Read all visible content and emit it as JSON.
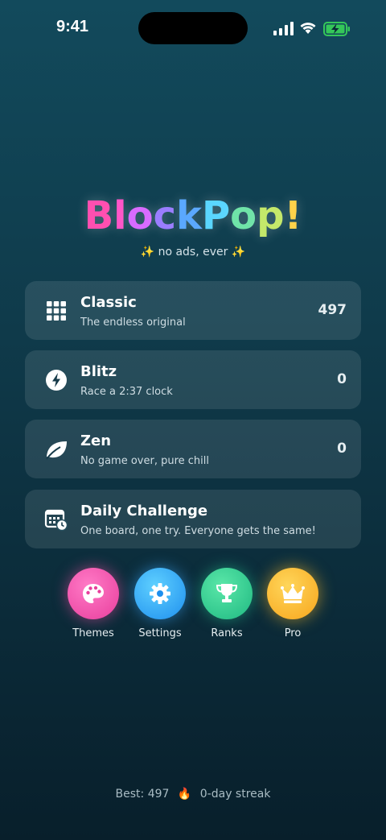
{
  "status": {
    "time": "9:41"
  },
  "logo": {
    "letters": [
      "B",
      "l",
      "o",
      "c",
      "k",
      "P",
      "o",
      "p",
      "!"
    ],
    "colors": [
      "#ff4fb0",
      "#ff55c8",
      "#d86bff",
      "#9a7dff",
      "#5aa8ff",
      "#5ad6ff",
      "#6fe3a8",
      "#c4e86a",
      "#ffd24a"
    ]
  },
  "tagline": {
    "spark_left": "✨",
    "text": "no ads, ever",
    "spark_right": "✨"
  },
  "modes": [
    {
      "title": "Classic",
      "subtitle": "The endless original",
      "score": "497",
      "icon": "grid-icon"
    },
    {
      "title": "Blitz",
      "subtitle": "Race a 2:37 clock",
      "score": "0",
      "icon": "lightning-icon"
    },
    {
      "title": "Zen",
      "subtitle": "No game over, pure chill",
      "score": "0",
      "icon": "leaf-icon"
    },
    {
      "title": "Daily Challenge",
      "subtitle": "One board, one try. Everyone gets the same!",
      "score": "",
      "icon": "calendar-clock-icon"
    }
  ],
  "actions": [
    {
      "label": "Themes",
      "icon": "palette-icon"
    },
    {
      "label": "Settings",
      "icon": "gear-icon"
    },
    {
      "label": "Ranks",
      "icon": "trophy-icon"
    },
    {
      "label": "Pro",
      "icon": "crown-icon"
    }
  ],
  "footer": {
    "best": "Best: 497",
    "flame": "🔥",
    "streak": "0-day streak"
  }
}
